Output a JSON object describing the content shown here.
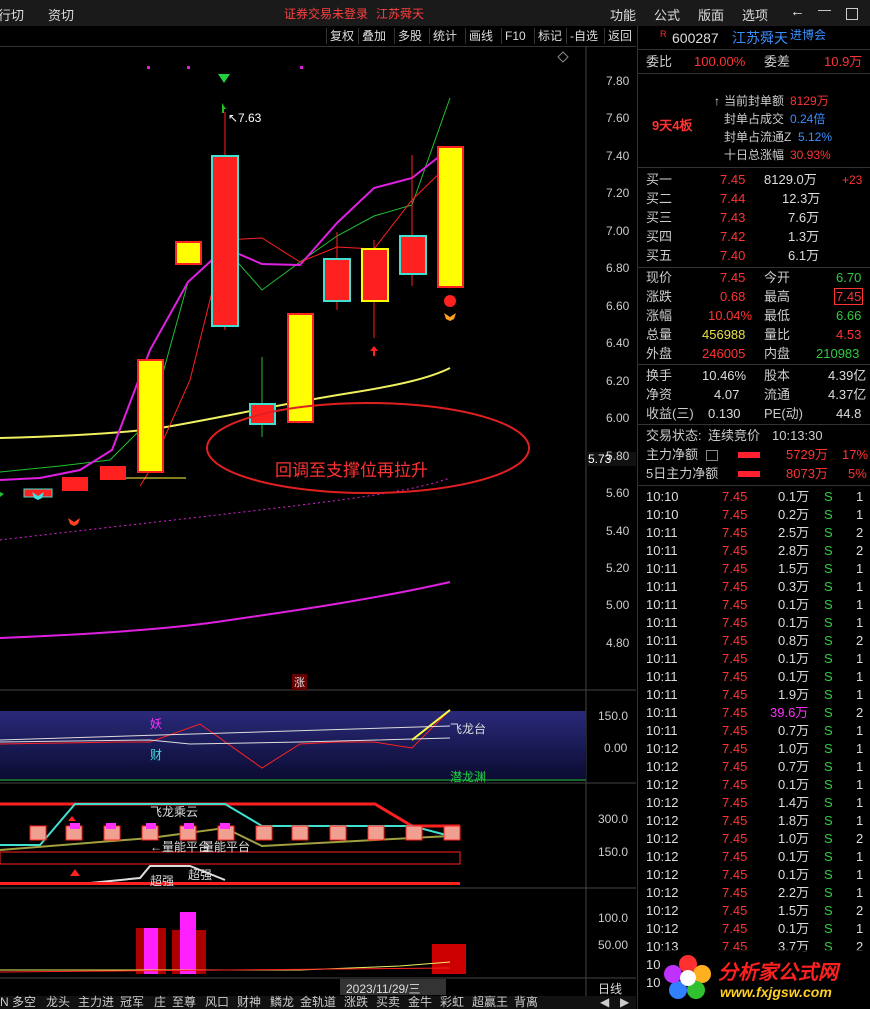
{
  "menubar": {
    "left1": "行切",
    "left2": "资切",
    "login_status": "证券交易未登录",
    "stock_name": "江苏舜天",
    "menu_items": [
      "功能",
      "公式",
      "版面",
      "选项"
    ]
  },
  "toolbar": {
    "buttons": [
      "复权",
      "叠加",
      "多股",
      "统计",
      "画线",
      "F10",
      "标记",
      "-自选",
      "返回"
    ]
  },
  "chart": {
    "price_labels": [
      "7.80",
      "7.60",
      "7.40",
      "7.20",
      "7.00",
      "6.80",
      "6.60",
      "6.40",
      "6.20",
      "6.00",
      "5.80",
      "5.60",
      "5.40",
      "5.20",
      "5.00",
      "4.80"
    ],
    "current_price_tag": "5.73",
    "high_label": "7.63",
    "annotation": "回调至支撑位再拉升",
    "zhang_label": "涨",
    "sub1_labels": [
      "150.0",
      "0.00"
    ],
    "sub1_text_feilong": "飞龙台",
    "sub1_text_qianlong": "潜龙渊",
    "sub1_text_yao": "妖",
    "sub1_text_cai": "财",
    "sub2_labels": [
      "300.0",
      "150.0"
    ],
    "sub2_text_feilong": "飞龙乘云",
    "sub2_text_pingtai": "←量能平台",
    "sub2_text_liangping": "量能平台",
    "sub2_text_chaoqiang1": "超强",
    "sub2_text_chaoqiang2": "超强",
    "sub3_labels": [
      "100.0",
      "50.00"
    ],
    "date_label": "2023/11/29/三",
    "period_label": "日线"
  },
  "bottom_tabs": [
    "N",
    "多空",
    "龙头",
    "主力进",
    "冠军",
    "庄",
    "至尊",
    "风口",
    "财神",
    "鳞龙",
    "金轨道",
    "涨跌",
    "买卖",
    "金牛",
    "彩虹",
    "超赢王",
    "背离"
  ],
  "quote": {
    "code": "600287",
    "name": "江苏舜天",
    "tag": "进博会",
    "r_badge": "R",
    "weibi_label": "委比",
    "weibi_value": "100.00%",
    "weicha_label": "委差",
    "weicha_value": "10.9万",
    "streak": "9天4板",
    "fengdan_label": "当前封单额",
    "fengdan_value": "8129万",
    "fengdan_chengjiao_label": "封单占成交",
    "fengdan_chengjiao_value": "0.24倍",
    "fengdan_liutong_label": "封单占流通Z",
    "fengdan_liutong_value": "5.12%",
    "shiri_label": "十日总涨幅",
    "shiri_value": "30.93%",
    "buy_levels": [
      {
        "label": "买一",
        "price": "7.45",
        "vol": "8129.0万",
        "chg": "+23"
      },
      {
        "label": "买二",
        "price": "7.44",
        "vol": "12.3万",
        "chg": ""
      },
      {
        "label": "买三",
        "price": "7.43",
        "vol": "7.6万",
        "chg": ""
      },
      {
        "label": "买四",
        "price": "7.42",
        "vol": "1.3万",
        "chg": ""
      },
      {
        "label": "买五",
        "price": "7.40",
        "vol": "6.1万",
        "chg": ""
      }
    ],
    "stats": [
      {
        "l1": "现价",
        "v1": "7.45",
        "l2": "今开",
        "v2": "6.70",
        "c1": "red",
        "c2": "green"
      },
      {
        "l1": "涨跌",
        "v1": "0.68",
        "l2": "最高",
        "v2": "7.45",
        "c1": "red",
        "c2": "red"
      },
      {
        "l1": "涨幅",
        "v1": "10.04%",
        "l2": "最低",
        "v2": "6.66",
        "c1": "red",
        "c2": "green"
      },
      {
        "l1": "总量",
        "v1": "456988",
        "l2": "量比",
        "v2": "4.53",
        "c1": "yellow",
        "c2": "red"
      },
      {
        "l1": "外盘",
        "v1": "246005",
        "l2": "内盘",
        "v2": "210983",
        "c1": "red",
        "c2": "green"
      }
    ],
    "stats2": [
      {
        "l1": "换手",
        "v1": "10.46%",
        "l2": "股本",
        "v2": "4.39亿"
      },
      {
        "l1": "净资",
        "v1": "4.07",
        "l2": "流通",
        "v2": "4.37亿"
      },
      {
        "l1": "收益(三)",
        "v1": "0.130",
        "l2": "PE(动)",
        "v2": "44.8"
      }
    ],
    "trade_state_label": "交易状态:",
    "trade_state": "连续竞价",
    "trade_time": "10:13:30",
    "main_net_label": "主力净额",
    "main_net_value": "5729万",
    "main_net_pct": "17%",
    "main5_label": "5日主力净额",
    "main5_value": "8073万",
    "main5_pct": "5%",
    "ticks": [
      {
        "t": "10:10",
        "p": "7.45",
        "v": "0.1万",
        "s": "S",
        "n": "1"
      },
      {
        "t": "10:10",
        "p": "7.45",
        "v": "0.2万",
        "s": "S",
        "n": "1"
      },
      {
        "t": "10:11",
        "p": "7.45",
        "v": "2.5万",
        "s": "S",
        "n": "2"
      },
      {
        "t": "10:11",
        "p": "7.45",
        "v": "2.8万",
        "s": "S",
        "n": "2"
      },
      {
        "t": "10:11",
        "p": "7.45",
        "v": "1.5万",
        "s": "S",
        "n": "1"
      },
      {
        "t": "10:11",
        "p": "7.45",
        "v": "0.3万",
        "s": "S",
        "n": "1"
      },
      {
        "t": "10:11",
        "p": "7.45",
        "v": "0.1万",
        "s": "S",
        "n": "1"
      },
      {
        "t": "10:11",
        "p": "7.45",
        "v": "0.1万",
        "s": "S",
        "n": "1"
      },
      {
        "t": "10:11",
        "p": "7.45",
        "v": "0.8万",
        "s": "S",
        "n": "2"
      },
      {
        "t": "10:11",
        "p": "7.45",
        "v": "0.1万",
        "s": "S",
        "n": "1"
      },
      {
        "t": "10:11",
        "p": "7.45",
        "v": "0.1万",
        "s": "S",
        "n": "1"
      },
      {
        "t": "10:11",
        "p": "7.45",
        "v": "1.9万",
        "s": "S",
        "n": "1"
      },
      {
        "t": "10:11",
        "p": "7.45",
        "v": "39.6万",
        "s": "S",
        "n": "2",
        "hl": true
      },
      {
        "t": "10:11",
        "p": "7.45",
        "v": "0.7万",
        "s": "S",
        "n": "1"
      },
      {
        "t": "10:12",
        "p": "7.45",
        "v": "1.0万",
        "s": "S",
        "n": "1"
      },
      {
        "t": "10:12",
        "p": "7.45",
        "v": "0.7万",
        "s": "S",
        "n": "1"
      },
      {
        "t": "10:12",
        "p": "7.45",
        "v": "0.1万",
        "s": "S",
        "n": "1"
      },
      {
        "t": "10:12",
        "p": "7.45",
        "v": "1.4万",
        "s": "S",
        "n": "1"
      },
      {
        "t": "10:12",
        "p": "7.45",
        "v": "1.8万",
        "s": "S",
        "n": "1"
      },
      {
        "t": "10:12",
        "p": "7.45",
        "v": "1.0万",
        "s": "S",
        "n": "2"
      },
      {
        "t": "10:12",
        "p": "7.45",
        "v": "0.1万",
        "s": "S",
        "n": "1"
      },
      {
        "t": "10:12",
        "p": "7.45",
        "v": "0.1万",
        "s": "S",
        "n": "1"
      },
      {
        "t": "10:12",
        "p": "7.45",
        "v": "2.2万",
        "s": "S",
        "n": "1"
      },
      {
        "t": "10:12",
        "p": "7.45",
        "v": "1.5万",
        "s": "S",
        "n": "2"
      },
      {
        "t": "10:12",
        "p": "7.45",
        "v": "0.1万",
        "s": "S",
        "n": "1"
      },
      {
        "t": "10:13",
        "p": "7.45",
        "v": "3.7万",
        "s": "S",
        "n": "2"
      },
      {
        "t": "10",
        "p": "",
        "v": "",
        "s": "",
        "n": ""
      },
      {
        "t": "10",
        "p": "",
        "v": "",
        "s": "",
        "n": ""
      }
    ]
  },
  "watermark": {
    "cn": "分析家公式网",
    "url": "www.fxjgsw.com"
  },
  "colors": {
    "up": "#ff2020",
    "down": "#40e0d0",
    "yellow_candle": "#ffff00",
    "ma_magenta": "#e020e0",
    "ma_yellow": "#ffff66"
  }
}
